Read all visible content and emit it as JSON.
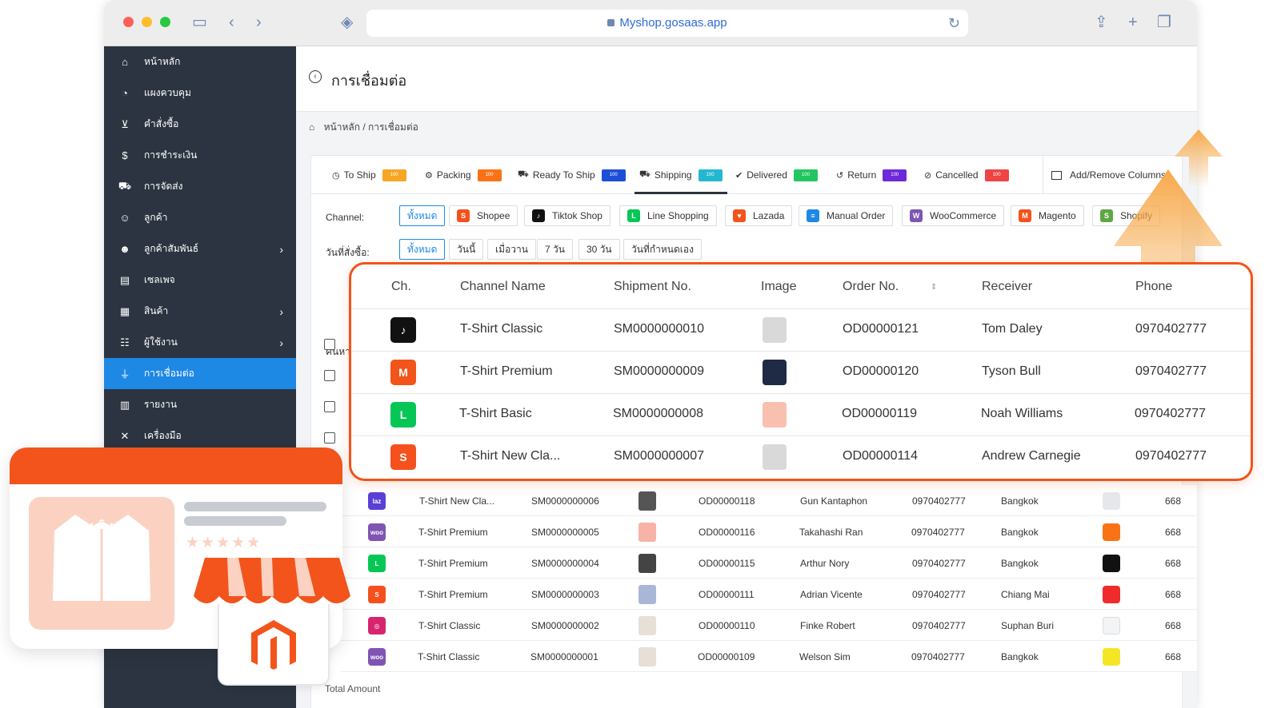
{
  "browser": {
    "address": "Myshop.gosaas.app"
  },
  "sidebar": {
    "items": [
      {
        "label": "หน้าหลัก",
        "icon": "home-icon"
      },
      {
        "label": "แผงควบคุม",
        "icon": "dashboard-icon"
      },
      {
        "label": "คำสั่งซื้อ",
        "icon": "cart-icon"
      },
      {
        "label": "การชำระเงิน",
        "icon": "dollar-icon"
      },
      {
        "label": "การจัดส่ง",
        "icon": "truck-icon"
      },
      {
        "label": "ลูกค้า",
        "icon": "users-icon"
      },
      {
        "label": "ลูกค้าสัมพันธ์",
        "icon": "crm-icon"
      },
      {
        "label": "เซลเพจ",
        "icon": "browser-icon"
      },
      {
        "label": "สินค้า",
        "icon": "boxes-icon"
      },
      {
        "label": "ผู้ใช้งาน",
        "icon": "user-group-icon"
      },
      {
        "label": "การเชื่อมต่อ",
        "icon": "plug-icon"
      },
      {
        "label": "รายงาน",
        "icon": "chart-icon"
      },
      {
        "label": "เครื่องมือ",
        "icon": "tools-icon"
      }
    ]
  },
  "page": {
    "title": "การเชื่อมต่อ",
    "breadcrumb_home": "หน้าหลัก",
    "breadcrumb_sep": "/",
    "breadcrumb_current": "การเชื่อมต่อ"
  },
  "tabs": [
    {
      "label": "To Ship",
      "badge": "100",
      "color": "#f5a623"
    },
    {
      "label": "Packing",
      "badge": "100",
      "color": "#f97316"
    },
    {
      "label": "Ready To Ship",
      "badge": "100",
      "color": "#1d4ed8"
    },
    {
      "label": "Shipping",
      "badge": "100",
      "color": "#22b8cf"
    },
    {
      "label": "Delivered",
      "badge": "100",
      "color": "#22c55e"
    },
    {
      "label": "Return",
      "badge": "100",
      "color": "#6d28d9"
    },
    {
      "label": "Cancelled",
      "badge": "100",
      "color": "#ef4444"
    }
  ],
  "add_columns": "Add/Remove Columns",
  "filters": {
    "channel_label": "Channel:",
    "channels": [
      "ทั้งหมด",
      "Shopee",
      "Tiktok Shop",
      "Line Shopping",
      "Lazada",
      "Manual Order",
      "WooCommerce",
      "Magento",
      "Shopify"
    ],
    "date_label": "วันที่สั่งซื้อ:",
    "dates": [
      "ทั้งหมด",
      "วันนี้",
      "เมื่อวาน",
      "7 วัน",
      "30 วัน",
      "วันที่กำหนดเอง"
    ],
    "search_label": "ค้นหา:"
  },
  "highlight_table": {
    "headers": [
      "Ch.",
      "Channel Name",
      "Shipment No.",
      "Image",
      "Order No.",
      "Receiver",
      "Phone"
    ],
    "rows": [
      {
        "channel": "Tiktok Shop",
        "name": "T-Shirt Classic",
        "shipment": "SM0000000010",
        "order": "OD00000121",
        "receiver": "Tom Daley",
        "phone": "0970402777"
      },
      {
        "channel": "Magento",
        "name": "T-Shirt Premium",
        "shipment": "SM0000000009",
        "order": "OD00000120",
        "receiver": "Tyson Bull",
        "phone": "0970402777"
      },
      {
        "channel": "Line Shopping",
        "name": "T-Shirt Basic",
        "shipment": "SM0000000008",
        "order": "OD00000119",
        "receiver": "Noah Williams",
        "phone": "0970402777"
      },
      {
        "channel": "Shopee",
        "name": "T-Shirt New Cla...",
        "shipment": "SM0000000007",
        "order": "OD00000114",
        "receiver": "Andrew Carnegie",
        "phone": "0970402777"
      }
    ]
  },
  "lower_table": {
    "rows": [
      {
        "name": "T-Shirt New Cla...",
        "shipment": "SM0000000006",
        "order": "OD00000118",
        "receiver": "Gun Kantaphon",
        "phone": "0970402777",
        "province": "Bangkok",
        "extra": "668"
      },
      {
        "name": "T-Shirt Premium",
        "shipment": "SM0000000005",
        "order": "OD00000116",
        "receiver": "Takahashi Ran",
        "phone": "0970402777",
        "province": "Bangkok",
        "extra": "668"
      },
      {
        "name": "T-Shirt Premium",
        "shipment": "SM0000000004",
        "order": "OD00000115",
        "receiver": "Arthur Nory",
        "phone": "0970402777",
        "province": "Bangkok",
        "extra": "668"
      },
      {
        "name": "T-Shirt Premium",
        "shipment": "SM0000000003",
        "order": "OD00000111",
        "receiver": "Adrian Vicente",
        "phone": "0970402777",
        "province": "Chiang Mai",
        "extra": "668"
      },
      {
        "name": "T-Shirt Classic",
        "shipment": "SM0000000002",
        "order": "OD00000110",
        "receiver": "Finke Robert",
        "phone": "0970402777",
        "province": "Suphan Buri",
        "extra": "668"
      },
      {
        "name": "T-Shirt Classic",
        "shipment": "SM0000000001",
        "order": "OD00000109",
        "receiver": "Welson Sim",
        "phone": "0970402777",
        "province": "Bangkok",
        "extra": "668"
      }
    ],
    "total_label": "Total Amount"
  },
  "colors": {
    "accent": "#1e88e5",
    "sidebar": "#2b3440",
    "highlight": "#f2541b"
  }
}
